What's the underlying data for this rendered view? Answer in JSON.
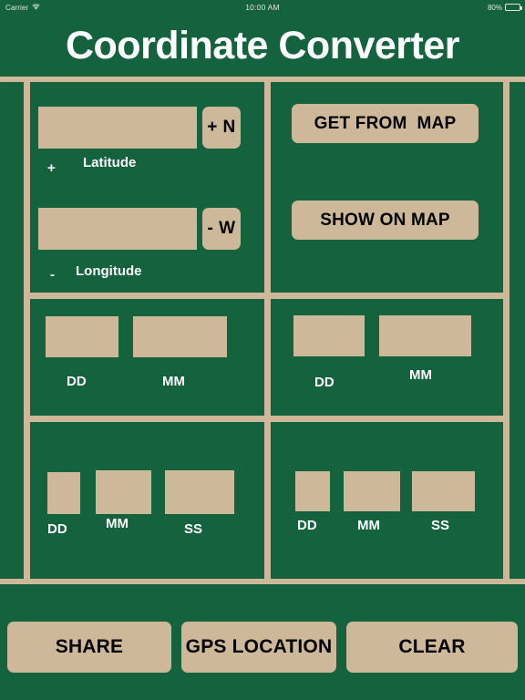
{
  "status_bar": {
    "carrier": "Carrier",
    "wifi_icon": "wifi-icon",
    "time": "10:00 AM",
    "battery_percent": "80%",
    "battery_icon": "battery-icon",
    "battery_level": 80
  },
  "header": {
    "title": "Coordinate Converter"
  },
  "decimal_panel": {
    "latitude": {
      "value": "",
      "placeholder": "",
      "hemisphere_button": "+ N",
      "sign_label": "+",
      "label": "Latitude"
    },
    "longitude": {
      "value": "",
      "placeholder": "",
      "hemisphere_button": "- W",
      "sign_label": "-",
      "label": "Longitude"
    }
  },
  "map_panel": {
    "get_from_map": "GET FROM  MAP",
    "show_on_map": "SHOW ON MAP"
  },
  "ddmm_left": {
    "dd": {
      "value": "",
      "label": "DD"
    },
    "mm": {
      "value": "",
      "label": "MM"
    }
  },
  "ddmm_right": {
    "dd": {
      "value": "",
      "label": "DD"
    },
    "mm": {
      "value": "",
      "label": "MM"
    }
  },
  "dms_left": {
    "dd": {
      "value": "",
      "label": "DD"
    },
    "mm": {
      "value": "",
      "label": "MM"
    },
    "ss": {
      "value": "",
      "label": "SS"
    }
  },
  "dms_right": {
    "dd": {
      "value": "",
      "label": "DD"
    },
    "mm": {
      "value": "",
      "label": "MM"
    },
    "ss": {
      "value": "",
      "label": "SS"
    }
  },
  "toolbar": {
    "share": "SHARE",
    "gps_location": "GPS LOCATION",
    "clear": "CLEAR"
  },
  "colors": {
    "background_green": "#15623f",
    "field_tan": "#cdb99a",
    "text_white": "#ffffff",
    "text_black": "#000000"
  }
}
